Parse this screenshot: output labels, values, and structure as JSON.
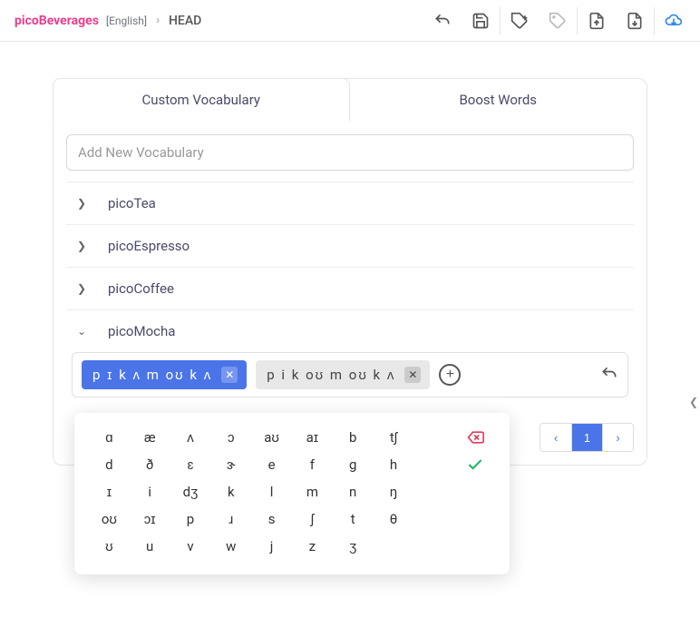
{
  "header": {
    "brand": "picoBeverages",
    "language": "[English]",
    "crumb_sep": "›",
    "head": "HEAD"
  },
  "tabs": {
    "custom": "Custom Vocabulary",
    "boost": "Boost Words"
  },
  "inputs": {
    "add_vocab_placeholder": "Add New Vocabulary"
  },
  "vocab": {
    "items": [
      {
        "name": "picoTea",
        "expanded": false
      },
      {
        "name": "picoEspresso",
        "expanded": false
      },
      {
        "name": "picoCoffee",
        "expanded": false
      },
      {
        "name": "picoMocha",
        "expanded": true
      }
    ]
  },
  "chips": {
    "c0": "p ɪ k ʌ m oʊ k ʌ",
    "c1": "p i k oʊ m oʊ k ʌ"
  },
  "ipa": {
    "keys": [
      "ɑ",
      "æ",
      "ʌ",
      "ɔ",
      "aʊ",
      "aɪ",
      "b",
      "tʃ",
      "d",
      "ð",
      "ɛ",
      "ɝ",
      "e",
      "f",
      "g",
      "h",
      "ɪ",
      "i",
      "dʒ",
      "k",
      "l",
      "m",
      "n",
      "ŋ",
      "oʊ",
      "ɔɪ",
      "p",
      "ɹ",
      "s",
      "ʃ",
      "t",
      "θ",
      "ʊ",
      "u",
      "v",
      "w",
      "j",
      "z",
      "ʒ"
    ]
  },
  "pagination": {
    "page": "1"
  },
  "colors": {
    "brand_pink": "#e83e8c",
    "primary_blue": "#4a74e8",
    "cloud_blue": "#2f86eb",
    "delete_red": "#e03d5b",
    "confirm_green": "#27b36b"
  }
}
